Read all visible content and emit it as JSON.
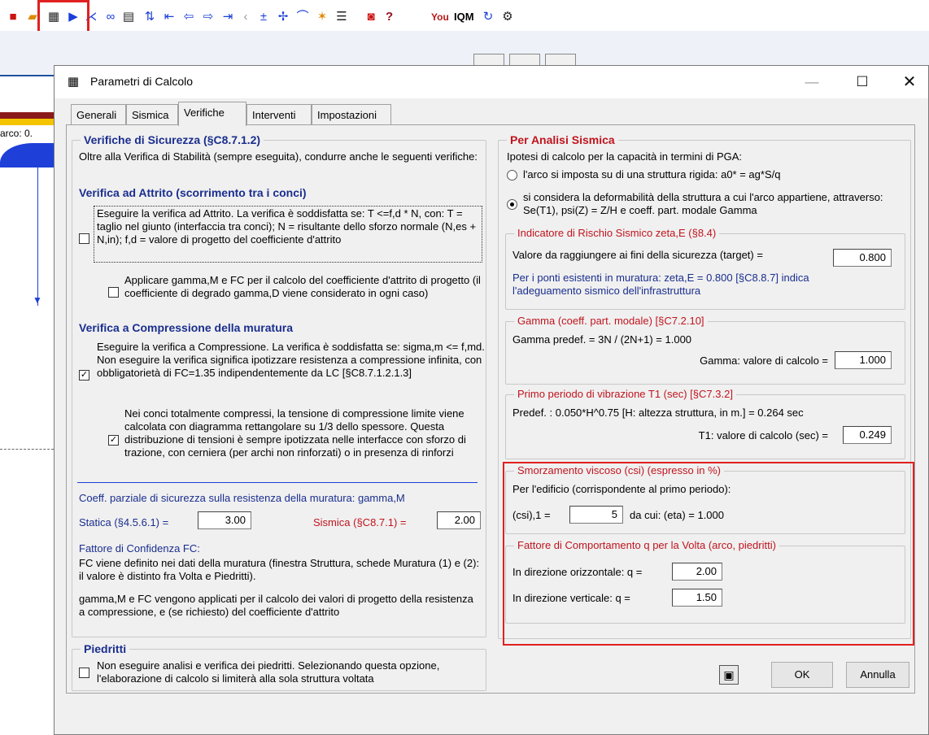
{
  "toolbar": {
    "icons": [
      "new-doc-icon",
      "open-icon",
      "calculator-icon",
      "run-icon",
      "diagram-icon",
      "glasses-icon",
      "table-icon",
      "sort-icon",
      "first-icon",
      "prev-icon",
      "next-icon",
      "last-icon",
      "step-icon",
      "plus-icon",
      "plus-cross-icon",
      "arc-icon",
      "star-icon",
      "list-icon",
      "pdf-icon",
      "help-icon",
      "youtube-icon",
      "iqm-icon",
      "refresh-icon",
      "settings-icon"
    ],
    "youtube_label": "You",
    "iqm_label": "IQM",
    "help_label": "?"
  },
  "background": {
    "arc_label": "arco: 0."
  },
  "dialog": {
    "title": "Parametri di Calcolo",
    "min_label": "—",
    "max_label": "☐",
    "close_label": "✕",
    "tabs": [
      {
        "label": "Generali"
      },
      {
        "label": "Sismica"
      },
      {
        "label": "Verifiche"
      },
      {
        "label": "Interventi"
      },
      {
        "label": "Impostazioni"
      }
    ],
    "ok_label": "OK",
    "cancel_label": "Annulla"
  },
  "left": {
    "safety_title": "Verifiche di Sicurezza (§C8.7.1.2)",
    "intro": "Oltre alla Verifica di Stabilità (sempre eseguita), condurre anche le seguenti verifiche:",
    "friction_head": "Verifica ad Attrito (scorrimento tra i conci)",
    "friction_text": "Eseguire la verifica ad Attrito. La verifica è soddisfatta se: T <=f,d * N, con: T = taglio nel giunto (interfaccia tra conci); N = risultante dello sforzo normale (N,es + N,in); f,d = valore di progetto del coefficiente d'attrito",
    "friction_checked": false,
    "gamma_text": "Applicare gamma,M e FC per il calcolo del coefficiente d'attrito di progetto (il coefficiente di degrado gamma,D viene considerato in ogni caso)",
    "gamma_checked": false,
    "compression_head": "Verifica a Compressione della muratura",
    "compression_text": "Eseguire la verifica a Compressione. La verifica è soddisfatta se: sigma,m <= f,md. Non eseguire la verifica significa ipotizzare resistenza a compressione infinita, con obbligatorietà di FC=1.35 indipendentemente da LC [§C8.7.1.2.1.3]",
    "compression_checked": true,
    "compressed_text": "Nei conci totalmente compressi, la tensione di compressione limite viene calcolata con diagramma rettangolare su 1/3 dello spessore. Questa distribuzione di tensioni è sempre ipotizzata nelle interfacce con sforzo di trazione, con cerniera (per archi non rinforzati) o in presenza di rinforzi",
    "compressed_checked": true,
    "coeff_title": "Coeff. parziale di sicurezza sulla resistenza della muratura: gamma,M",
    "static_label": "Statica (§4.5.6.1) =",
    "static_value": "3.00",
    "seismic_label": "Sismica (§C8.7.1) =",
    "seismic_value": "2.00",
    "fc_title": "Fattore di Confidenza FC:",
    "fc_text": "FC viene definito nei dati della muratura (finestra Struttura, schede Muratura (1) e (2): il valore è distinto fra Volta e Piedritti).",
    "gm_text": "gamma,M e FC vengono applicati per il calcolo dei valori di progetto della resistenza a compressione, e (se richiesto) del coefficiente d'attrito",
    "piedritti_title": "Piedritti",
    "piedritti_text": "Non eseguire analisi e verifica dei piedritti. Selezionando questa opzione, l'elaborazione di calcolo si limiterà alla sola struttura voltata",
    "piedritti_checked": false
  },
  "right": {
    "seismic_title": "Per Analisi Sismica",
    "hyp_text": "Ipotesi di calcolo per la capacità in termini di PGA:",
    "radio1": "l'arco si imposta su di una struttura rigida: a0* = ag*S/q",
    "radio1_checked": false,
    "radio2": "si considera la deformabilità della struttura a cui l'arco appartiene, attraverso: Se(T1), psi(Z) = Z/H e coeff. part. modale Gamma",
    "radio2_checked": true,
    "risk": {
      "title": "Indicatore di Rischio Sismico zeta,E (§8.4)",
      "label": "Valore da raggiungere ai fini della sicurezza (target) =",
      "value": "0.800",
      "note": "Per i ponti esistenti in muratura: zeta,E = 0.800 [§C8.8.7] indica l'adeguamento sismico dell'infrastruttura"
    },
    "gamma": {
      "title": "Gamma (coeff. part. modale) [§C7.2.10]",
      "predef": "Gamma predef. = 3N / (2N+1) = 1.000",
      "label": "Gamma: valore di calcolo =",
      "value": "1.000"
    },
    "period": {
      "title": "Primo periodo di vibrazione T1 (sec) [§C7.3.2]",
      "predef": "Predef. : 0.050*H^0.75  [H: altezza struttura, in m.] = 0.264 sec",
      "label": "T1: valore di calcolo (sec) =",
      "value": "0.249"
    },
    "damping": {
      "title": "Smorzamento viscoso (csi) (espresso in %)",
      "text": "Per l'edificio (corrispondente al primo periodo):",
      "label": "(csi),1 =",
      "value": "5",
      "suffix": "da cui: (eta) = 1.000"
    },
    "behavior": {
      "title": "Fattore di Comportamento q per la Volta (arco, piedritti)",
      "horiz_label": "In direzione orizzontale: q =",
      "horiz_value": "2.00",
      "vert_label": "In direzione verticale: q =",
      "vert_value": "1.50"
    }
  },
  "colors": {
    "accent_red": "#c0141e",
    "accent_blue": "#1a2e8e",
    "highlight": "#e02020"
  }
}
